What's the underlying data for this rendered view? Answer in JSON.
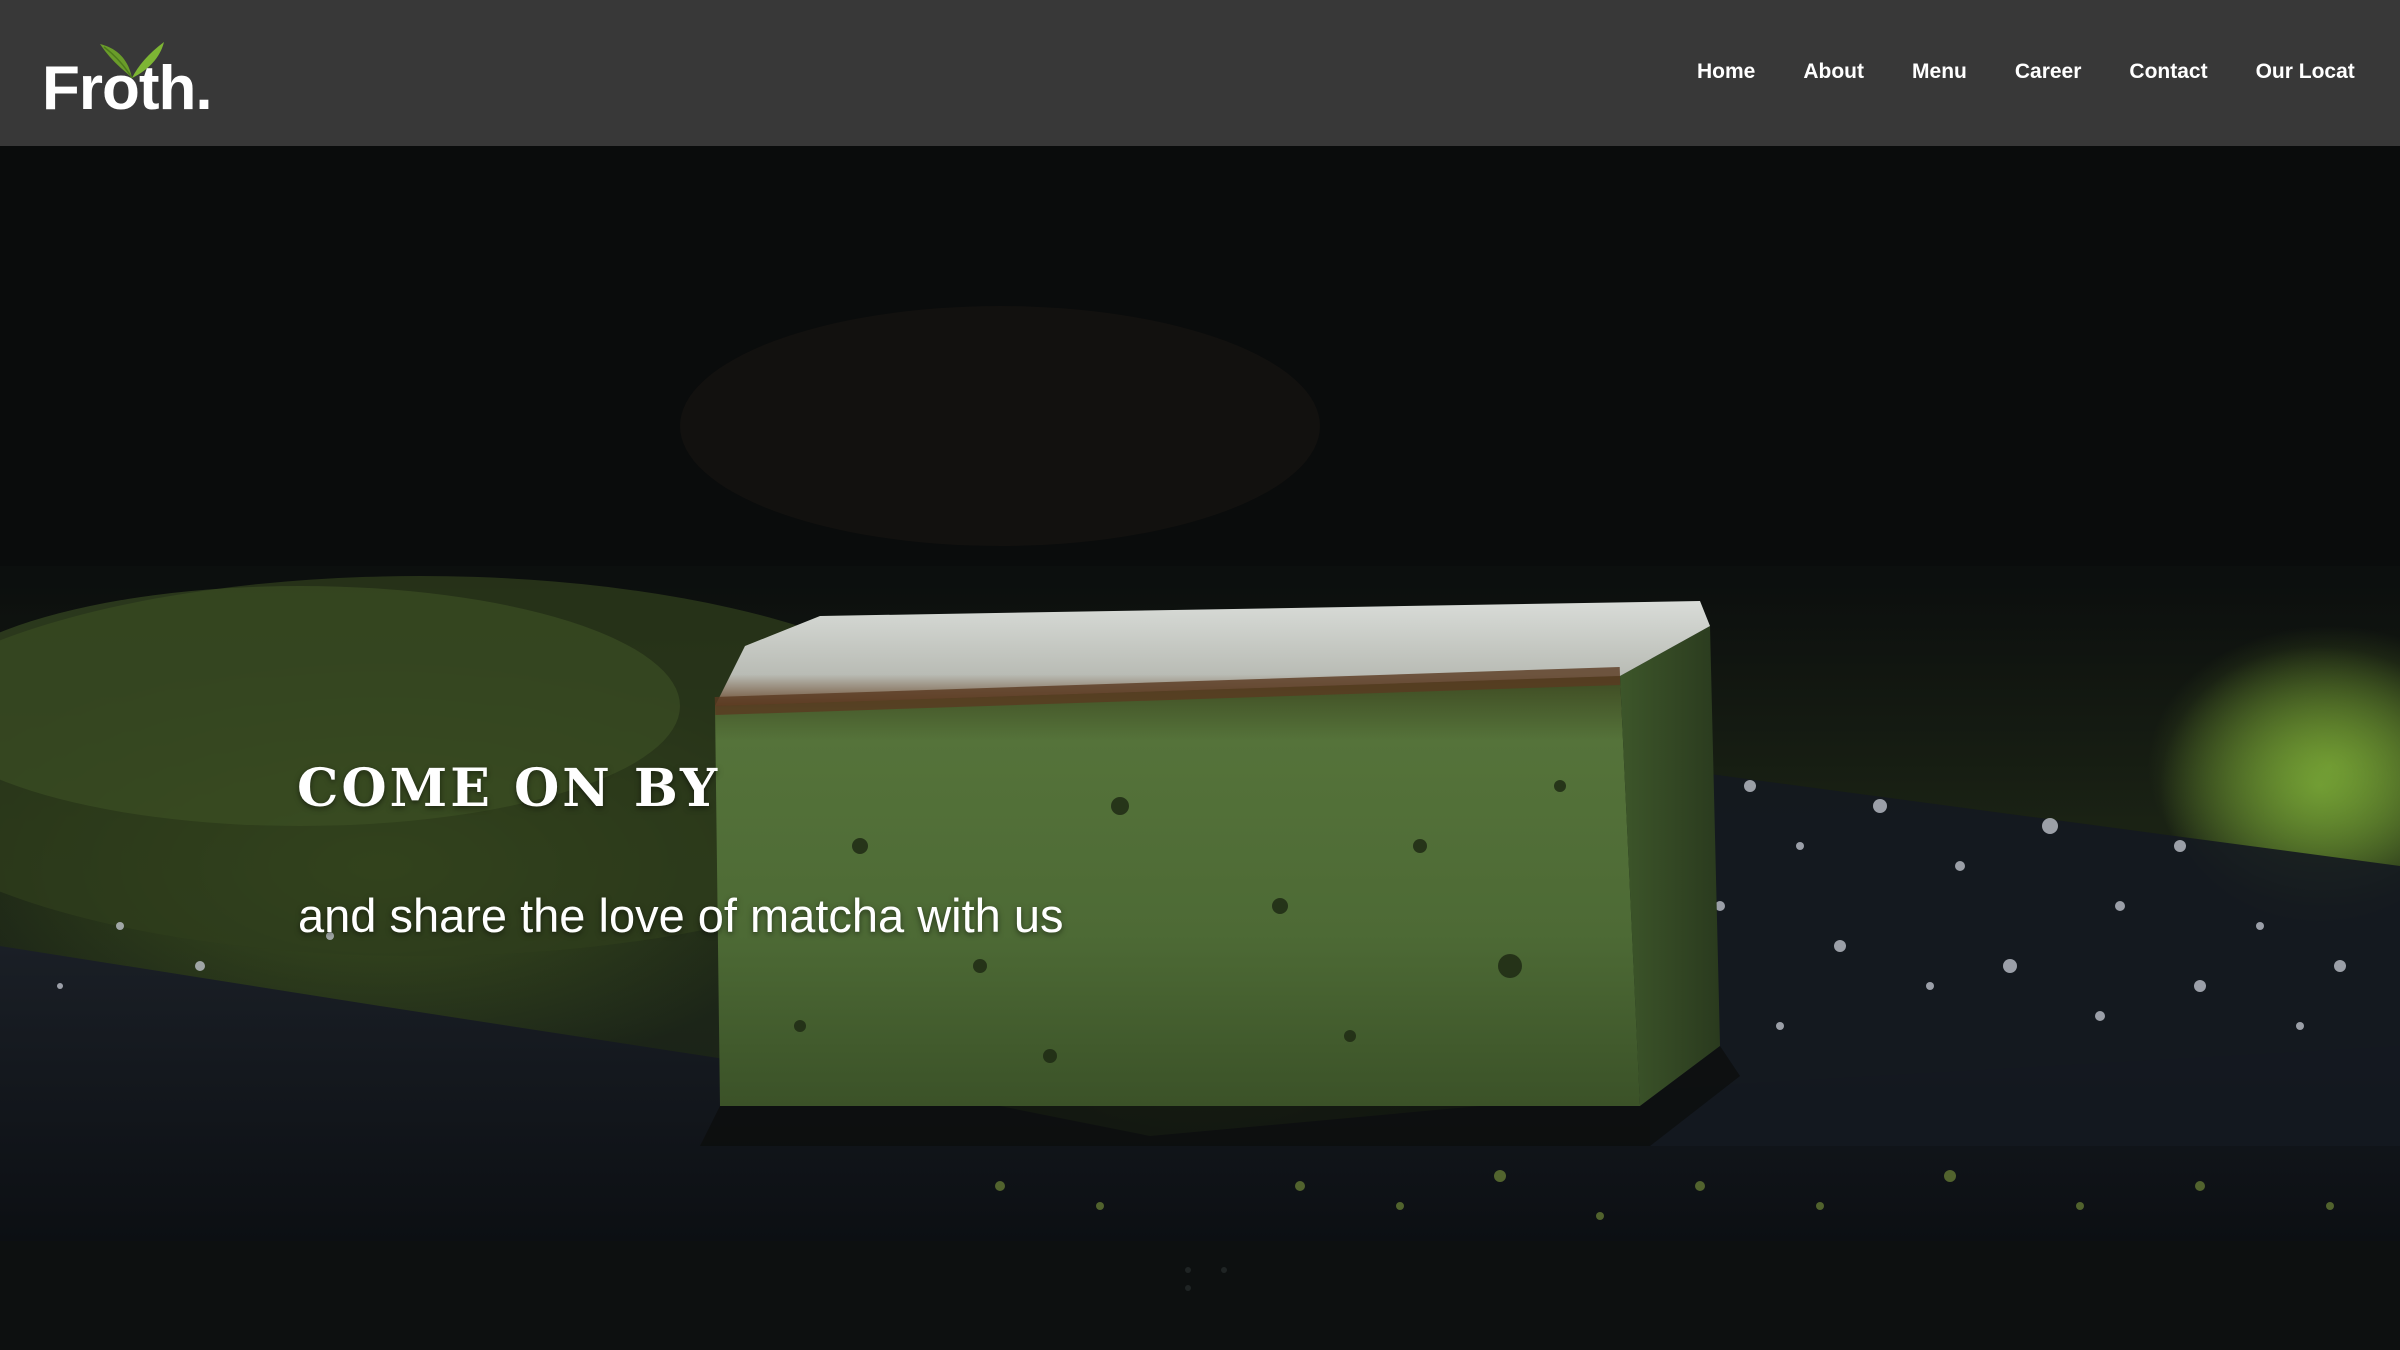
{
  "brand": {
    "logo_text": "Froth.",
    "logo_icon": "tea-leaf-icon",
    "leaf_color": "#6a9c2a"
  },
  "nav": {
    "items": [
      {
        "label": "Home"
      },
      {
        "label": "About"
      },
      {
        "label": "Menu"
      },
      {
        "label": "Career"
      },
      {
        "label": "Contact"
      },
      {
        "label": "Our Locat"
      }
    ]
  },
  "hero": {
    "title": "COME ON BY",
    "subtitle": "and share the love of matcha with us",
    "image": "matcha-brownie-photo"
  },
  "colors": {
    "header_bg": "#383838",
    "page_bg": "#0d1010",
    "text": "#ffffff",
    "matcha_green": "#5b7a3c"
  }
}
